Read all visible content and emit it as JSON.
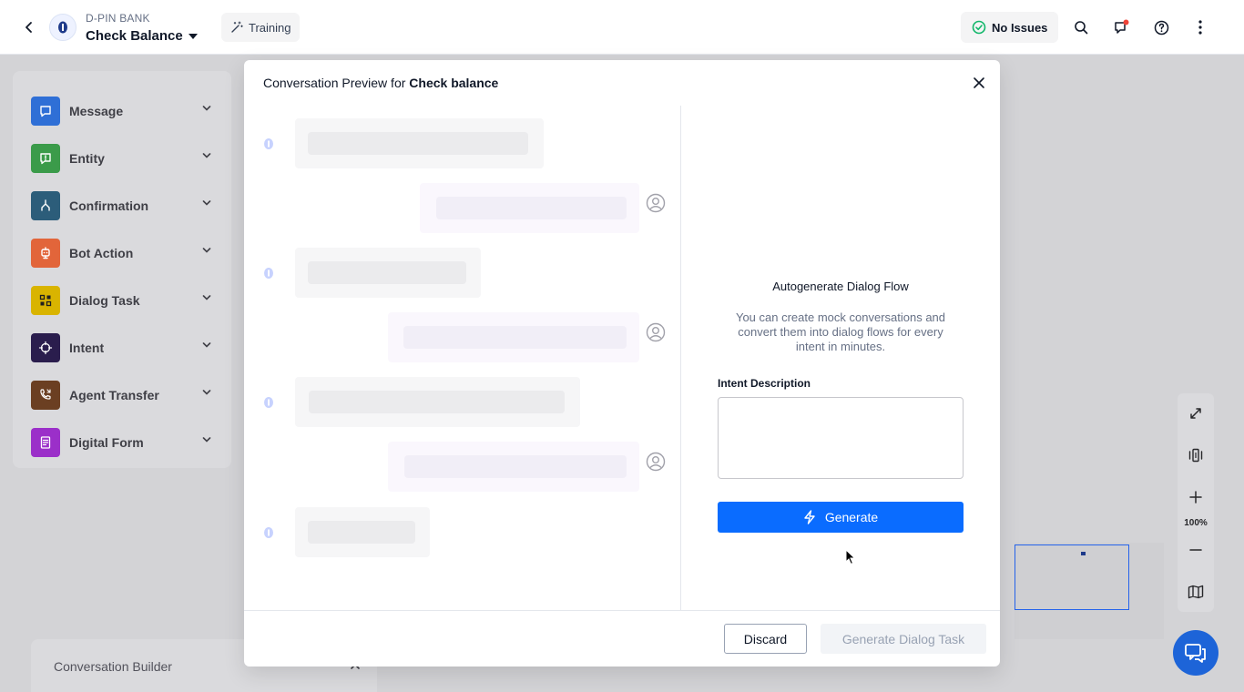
{
  "header": {
    "app_sub": "D-PIN BANK",
    "app_title": "Check Balance",
    "training_label": "Training",
    "status_label": "No Issues"
  },
  "palette": {
    "items": [
      {
        "label": "Message",
        "color": "#2f6fd6"
      },
      {
        "label": "Entity",
        "color": "#3b9b4a"
      },
      {
        "label": "Confirmation",
        "color": "#2c5d7a"
      },
      {
        "label": "Bot Action",
        "color": "#e2653a"
      },
      {
        "label": "Dialog Task",
        "color": "#d9b400"
      },
      {
        "label": "Intent",
        "color": "#2a1d4d"
      },
      {
        "label": "Agent Transfer",
        "color": "#6b3f22"
      },
      {
        "label": "Digital Form",
        "color": "#9b2fc9"
      }
    ]
  },
  "conversation_builder": {
    "label": "Conversation Builder"
  },
  "tools": {
    "zoom_level": "100%"
  },
  "modal": {
    "title_prefix": "Conversation Preview for ",
    "title_intent": "Check balance",
    "auto_title": "Autogenerate Dialog Flow",
    "auto_desc": "You can create mock conversations and convert them into dialog flows for every intent in minutes.",
    "intent_label": "Intent Description",
    "intent_value": "",
    "generate_label": "Generate",
    "discard_label": "Discard",
    "generate_dialog_label": "Generate Dialog Task"
  },
  "colors": {
    "primary": "#0a6cff",
    "success": "#12b76a",
    "notification": "#f04438"
  }
}
